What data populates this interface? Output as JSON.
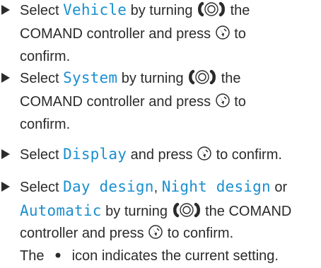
{
  "steps": [
    {
      "lines": [
        [
          "Select ",
          {
            "menu": "Vehicle"
          },
          " by turning ",
          {
            "icon": "turn"
          },
          " the"
        ],
        [
          "COMAND controller and press ",
          {
            "icon": "press"
          },
          " to"
        ],
        [
          "confirm."
        ]
      ]
    },
    {
      "lines": [
        [
          "Select ",
          {
            "menu": "System"
          },
          " by turning ",
          {
            "icon": "turn"
          },
          " the"
        ],
        [
          "COMAND controller and press ",
          {
            "icon": "press"
          },
          " to"
        ],
        [
          "confirm."
        ]
      ]
    },
    {
      "lines": [
        [
          "Select ",
          {
            "menu": "Display"
          },
          " and press ",
          {
            "icon": "press"
          },
          " to confirm."
        ]
      ]
    },
    {
      "lines": [
        [
          "Select ",
          {
            "menu": "Day design"
          },
          ", ",
          {
            "menu": "Night design"
          },
          " or"
        ],
        [
          {
            "menu": "Automatic"
          },
          " by turning ",
          {
            "icon": "turn"
          },
          " the COMAND"
        ],
        [
          "controller and press ",
          {
            "icon": "press"
          },
          " to confirm."
        ],
        [
          "The ",
          {
            "icon": "dot"
          },
          " icon indicates the current setting."
        ]
      ]
    }
  ],
  "icons": {
    "turn": "controller-turn-icon",
    "press": "controller-press-icon",
    "dot": "current-setting-dot-icon"
  },
  "colors": {
    "text": "#2b2b2b",
    "menu_highlight": "#1a8fcf"
  }
}
